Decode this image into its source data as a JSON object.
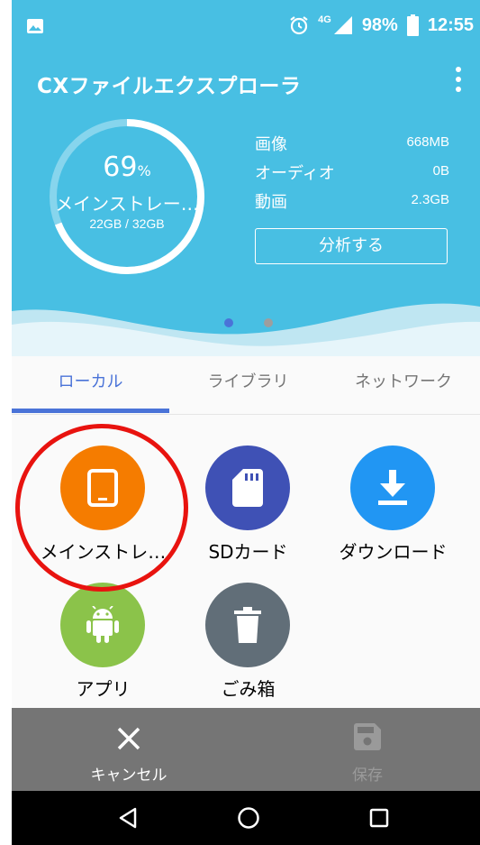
{
  "status_bar": {
    "battery": "98%",
    "time": "12:55",
    "network": "4G",
    "icons": [
      "image-notification-icon",
      "alarm-icon",
      "signal-icon",
      "battery-icon"
    ]
  },
  "header": {
    "title": "CXファイルエクスプローラ",
    "menu_icon": "more-vert-icon",
    "colors": {
      "background": "#48bfe3",
      "wave": "#d9f0f7"
    }
  },
  "storage": {
    "percent": "69",
    "percent_unit": "%",
    "percent_value": 0.69,
    "label": "メインストレー…",
    "usage": "22GB / 32GB"
  },
  "stats": [
    {
      "name": "画像",
      "value": "668MB"
    },
    {
      "name": "オーディオ",
      "value": "0B"
    },
    {
      "name": "動画",
      "value": "2.3GB"
    }
  ],
  "analyze_button": "分析する",
  "pager": {
    "current": 1,
    "total": 2,
    "active_color": "#4a73d8",
    "inactive_color": "#9e9e9e"
  },
  "tabs": [
    {
      "label": "ローカル",
      "active": true
    },
    {
      "label": "ライブラリ",
      "active": false
    },
    {
      "label": "ネットワーク",
      "active": false
    }
  ],
  "grid": [
    {
      "label": "メインストレ…",
      "icon": "tablet-icon",
      "color": "#f57c00"
    },
    {
      "label": "SDカード",
      "icon": "sd-card-icon",
      "color": "#3f51b5"
    },
    {
      "label": "ダウンロード",
      "icon": "download-icon",
      "color": "#2196f3"
    },
    {
      "label": "アプリ",
      "icon": "android-icon",
      "color": "#8bc34a"
    },
    {
      "label": "ごみ箱",
      "icon": "trash-icon",
      "color": "#616e78"
    }
  ],
  "actions": {
    "cancel": {
      "label": "キャンセル",
      "icon": "close-icon"
    },
    "save": {
      "label": "保存",
      "icon": "save-icon",
      "enabled": false
    }
  },
  "nav_bar": {
    "icons": [
      "back-icon",
      "home-icon",
      "recents-icon"
    ]
  }
}
